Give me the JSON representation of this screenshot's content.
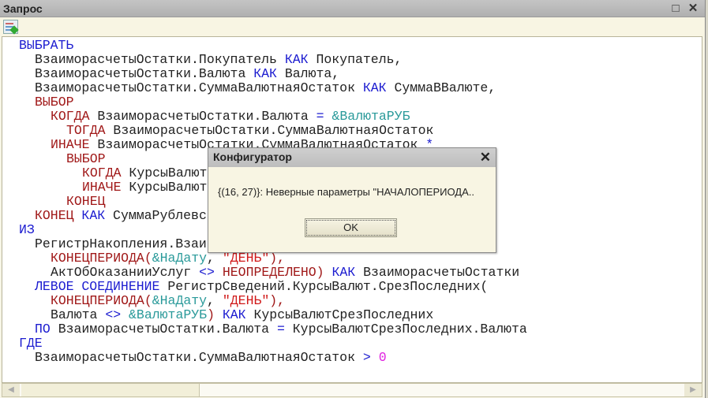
{
  "window": {
    "title": "Запрос",
    "maximize_icon": "maximize-icon",
    "close_icon": "close-icon"
  },
  "toolbar": {
    "icon": "query-wizard-icon"
  },
  "code_colors": {
    "keyword": "#1c1cd0",
    "function": "#a01818",
    "parameter": "#2a9a9a",
    "string": "#d01818",
    "number": "#e020e0"
  },
  "code": [
    {
      "indent": 0,
      "tokens": [
        [
          "ВЫБРАТЬ",
          "kw"
        ]
      ]
    },
    {
      "indent": 1,
      "tokens": [
        [
          "ВзаиморасчетыОстатки.Покупатель ",
          "id"
        ],
        [
          "КАК",
          "kw"
        ],
        [
          " Покупатель,",
          "id"
        ]
      ]
    },
    {
      "indent": 1,
      "tokens": [
        [
          "ВзаиморасчетыОстатки.Валюта ",
          "id"
        ],
        [
          "КАК",
          "kw"
        ],
        [
          " Валюта,",
          "id"
        ]
      ]
    },
    {
      "indent": 1,
      "tokens": [
        [
          "ВзаиморасчетыОстатки.СуммаВалютнаяОстаток ",
          "id"
        ],
        [
          "КАК",
          "kw"
        ],
        [
          " СуммаВВалюте,",
          "id"
        ]
      ]
    },
    {
      "indent": 1,
      "tokens": [
        [
          "ВЫБОР",
          "fn"
        ]
      ]
    },
    {
      "indent": 2,
      "tokens": [
        [
          "КОГДА",
          "fn"
        ],
        [
          " ВзаиморасчетыОстатки.Валюта ",
          "id"
        ],
        [
          "=",
          "op"
        ],
        [
          " ",
          "id"
        ],
        [
          "&ВалютаРУБ",
          "par"
        ]
      ]
    },
    {
      "indent": 3,
      "tokens": [
        [
          "ТОГДА",
          "fn"
        ],
        [
          " ВзаиморасчетыОстатки.СуммаВалютнаяОстаток",
          "id"
        ]
      ]
    },
    {
      "indent": 2,
      "tokens": [
        [
          "ИНАЧЕ",
          "fn"
        ],
        [
          " ВзаиморасчетыОстатки.СуммаВалютнаяОстаток ",
          "id"
        ],
        [
          "*",
          "op"
        ]
      ]
    },
    {
      "indent": 3,
      "tokens": [
        [
          "ВЫБОР",
          "fn"
        ]
      ]
    },
    {
      "indent": 4,
      "tokens": [
        [
          "КОГДА",
          "fn"
        ],
        [
          " КурсыВалют",
          "id"
        ]
      ]
    },
    {
      "indent": 4,
      "tokens": [
        [
          "ИНАЧЕ",
          "fn"
        ],
        [
          " КурсыВалют",
          "id"
        ]
      ]
    },
    {
      "indent": 3,
      "tokens": [
        [
          "КОНЕЦ",
          "fn"
        ]
      ]
    },
    {
      "indent": 1,
      "tokens": [
        [
          "КОНЕЦ",
          "fn"
        ],
        [
          " ",
          "id"
        ],
        [
          "КАК",
          "kw"
        ],
        [
          " СуммаРублевс",
          "id"
        ]
      ]
    },
    {
      "indent": 0,
      "tokens": [
        [
          "ИЗ",
          "kw"
        ]
      ]
    },
    {
      "indent": 1,
      "tokens": [
        [
          "РегистрНакопления.Взаи",
          "id"
        ]
      ]
    },
    {
      "indent": 2,
      "tokens": [
        [
          "КОНЕЦПЕРИОДА(",
          "fn"
        ],
        [
          "&НаДату",
          "par"
        ],
        [
          ", ",
          "id"
        ],
        [
          "\"ДЕНЬ\"",
          "str"
        ],
        [
          "),",
          "fn"
        ]
      ]
    },
    {
      "indent": 2,
      "tokens": [
        [
          "АктОбОказанииУслуг ",
          "id"
        ],
        [
          "<>",
          "op"
        ],
        [
          " ",
          "id"
        ],
        [
          "НЕОПРЕДЕЛЕНО)",
          "fn"
        ],
        [
          " ",
          "id"
        ],
        [
          "КАК",
          "kw"
        ],
        [
          " ВзаиморасчетыОстатки",
          "id"
        ]
      ]
    },
    {
      "indent": 1,
      "tokens": [
        [
          "ЛЕВОЕ СОЕДИНЕНИЕ",
          "kw"
        ],
        [
          " РегистрСведений.КурсыВалют.СрезПоследних(",
          "id"
        ]
      ]
    },
    {
      "indent": 2,
      "tokens": [
        [
          "КОНЕЦПЕРИОДА(",
          "fn"
        ],
        [
          "&НаДату",
          "par"
        ],
        [
          ", ",
          "id"
        ],
        [
          "\"ДЕНЬ\"",
          "str"
        ],
        [
          "),",
          "fn"
        ]
      ]
    },
    {
      "indent": 2,
      "tokens": [
        [
          "Валюта ",
          "id"
        ],
        [
          "<>",
          "op"
        ],
        [
          " ",
          "id"
        ],
        [
          "&ВалютаРУБ",
          "par"
        ],
        [
          ")",
          "fn"
        ],
        [
          " ",
          "id"
        ],
        [
          "КАК",
          "kw"
        ],
        [
          " КурсыВалютСрезПоследних",
          "id"
        ]
      ]
    },
    {
      "indent": 1,
      "tokens": [
        [
          "ПО",
          "kw"
        ],
        [
          " ВзаиморасчетыОстатки.Валюта ",
          "id"
        ],
        [
          "=",
          "op"
        ],
        [
          " КурсыВалютСрезПоследних.Валюта",
          "id"
        ]
      ]
    },
    {
      "indent": 0,
      "tokens": [
        [
          "ГДЕ",
          "kw"
        ]
      ]
    },
    {
      "indent": 1,
      "tokens": [
        [
          "ВзаиморасчетыОстатки.СуммаВалютнаяОстаток ",
          "id"
        ],
        [
          ">",
          "op"
        ],
        [
          " ",
          "id"
        ],
        [
          "0",
          "num"
        ]
      ]
    }
  ],
  "dialog": {
    "title": "Конфигуратор",
    "message": "{(16, 27)}: Неверные параметры \"НАЧАЛОПЕРИОДА..",
    "ok_label": "OK"
  }
}
